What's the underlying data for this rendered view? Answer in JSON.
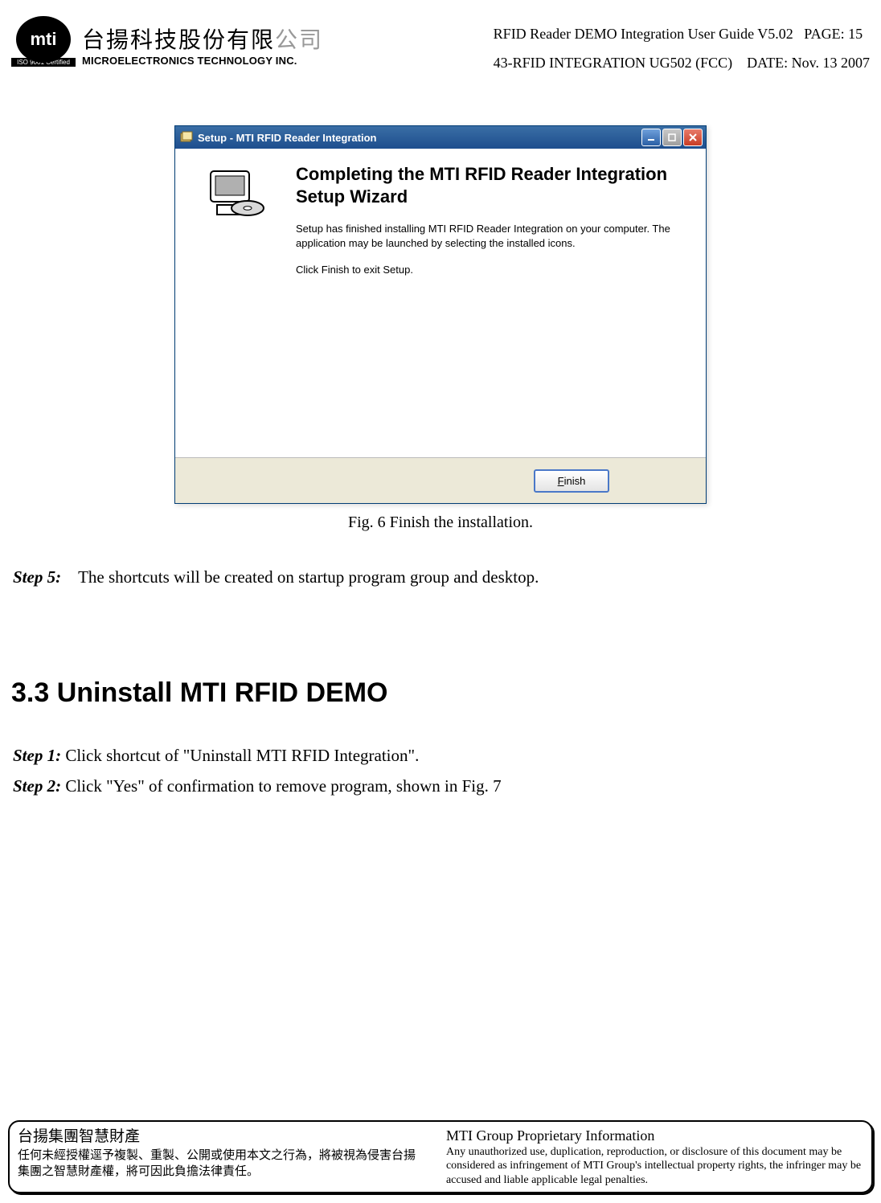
{
  "header": {
    "iso_label": "ISO 9001 Certified",
    "logo_text": "mti",
    "company_cn_a": "台揚科技股份有限",
    "company_cn_b": "公司",
    "company_en": "MICROELECTRONICS TECHNOLOGY INC.",
    "doc_title": "RFID Reader DEMO Integration User Guide V5.02",
    "page_label": "PAGE: 15",
    "doc_code": "43-RFID INTEGRATION UG502 (FCC)",
    "date_label": "DATE: Nov. 13 2007"
  },
  "setup_window": {
    "title": "Setup - MTI RFID Reader Integration",
    "wizard_title": "Completing the MTI RFID Reader Integration Setup Wizard",
    "wizard_text1": "Setup has finished installing MTI RFID Reader Integration on your computer. The application may be launched by selecting the installed icons.",
    "wizard_text2": "Click Finish to exit Setup.",
    "finish_btn_prefix": "F",
    "finish_btn_rest": "inish"
  },
  "figure_caption": "Fig. 6    Finish the installation.",
  "step5": {
    "label": "Step 5:",
    "text": "The shortcuts will be created on startup program group and desktop."
  },
  "section_heading": "3.3  Uninstall MTI RFID DEMO",
  "uninstall": {
    "step1_label": "Step 1:",
    "step1_text": " Click shortcut of \"Uninstall MTI RFID Integration\".",
    "step2_label": "Step 2:",
    "step2_text": " Click \"Yes\" of confirmation to remove program, shown in Fig. 7"
  },
  "footer": {
    "left_title": "台揚集團智慧財產",
    "left_body": "任何未經授權逕予複製、重製、公開或使用本文之行為，將被視為侵害台揚集團之智慧財產權，將可因此負擔法律責任。",
    "right_title": "MTI Group Proprietary Information",
    "right_body": "Any unauthorized use, duplication, reproduction, or disclosure of this document may be considered as infringement of MTI Group's intellectual property rights, the infringer may be accused and liable applicable legal penalties."
  }
}
